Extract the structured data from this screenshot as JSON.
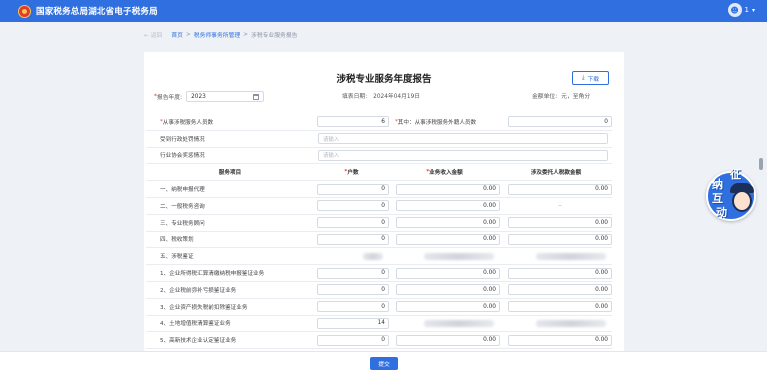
{
  "header": {
    "app_title": "国家税务总局湖北省电子税务局",
    "user_label": "1"
  },
  "breadcrumb": {
    "back": "返回",
    "home": "首页",
    "parent": "税务师事务所管理",
    "sep": ">",
    "current": "涉税专业服务报告"
  },
  "report": {
    "title": "涉税专业服务年度报告",
    "download_label": "下载",
    "year_label": "报告年度:",
    "year_value": "2023",
    "fill_date_label": "填表日期:",
    "fill_date_value": "2024年04月19日",
    "unit_label": "金额单位:",
    "unit_value": "元，至角分"
  },
  "top_rows": {
    "staff_label": "从事涉税服务人员数",
    "staff_value": "6",
    "external_label": "其中：从事涉税服务外籍人员数",
    "external_value": "0",
    "penalty_label": "受到行政处罚情况",
    "penalty_placeholder": "请输入",
    "association_label": "行业协会奖惩情况",
    "association_placeholder": "请输入"
  },
  "table": {
    "headers": [
      "服务项目",
      "户数",
      "业务收入金额",
      "涉及委托人税款金额"
    ],
    "rows": [
      {
        "name": "一、纳税申报代理",
        "households": "0",
        "income": "0.00",
        "tax": "0.00"
      },
      {
        "name": "二、一般税务咨询",
        "households": "0",
        "income": "0.00",
        "tax": "--"
      },
      {
        "name": "三、专业税务顾问",
        "households": "0",
        "income": "0.00",
        "tax": "0.00"
      },
      {
        "name": "四、税收策划",
        "households": "0",
        "income": "0.00",
        "tax": "0.00"
      },
      {
        "name": "五、涉税鉴证",
        "households": "",
        "income": "",
        "tax": ""
      },
      {
        "name": "1、企业所得税汇算清缴纳税申报鉴证业务",
        "households": "0",
        "income": "0.00",
        "tax": "0.00"
      },
      {
        "name": "2、企业税前弥补亏损鉴证业务",
        "households": "0",
        "income": "0.00",
        "tax": "0.00"
      },
      {
        "name": "3、企业资产损失税前扣除鉴证业务",
        "households": "0",
        "income": "0.00",
        "tax": "0.00"
      },
      {
        "name": "4、土地增值税清算鉴证业务",
        "households": "14",
        "income": "",
        "tax": ""
      },
      {
        "name": "5、高新技术企业认定鉴证业务",
        "households": "0",
        "income": "0.00",
        "tax": "0.00"
      }
    ]
  },
  "widget": {
    "chars": [
      "征",
      "纳",
      "互",
      "动"
    ]
  },
  "footer": {
    "submit_label": "提交"
  }
}
